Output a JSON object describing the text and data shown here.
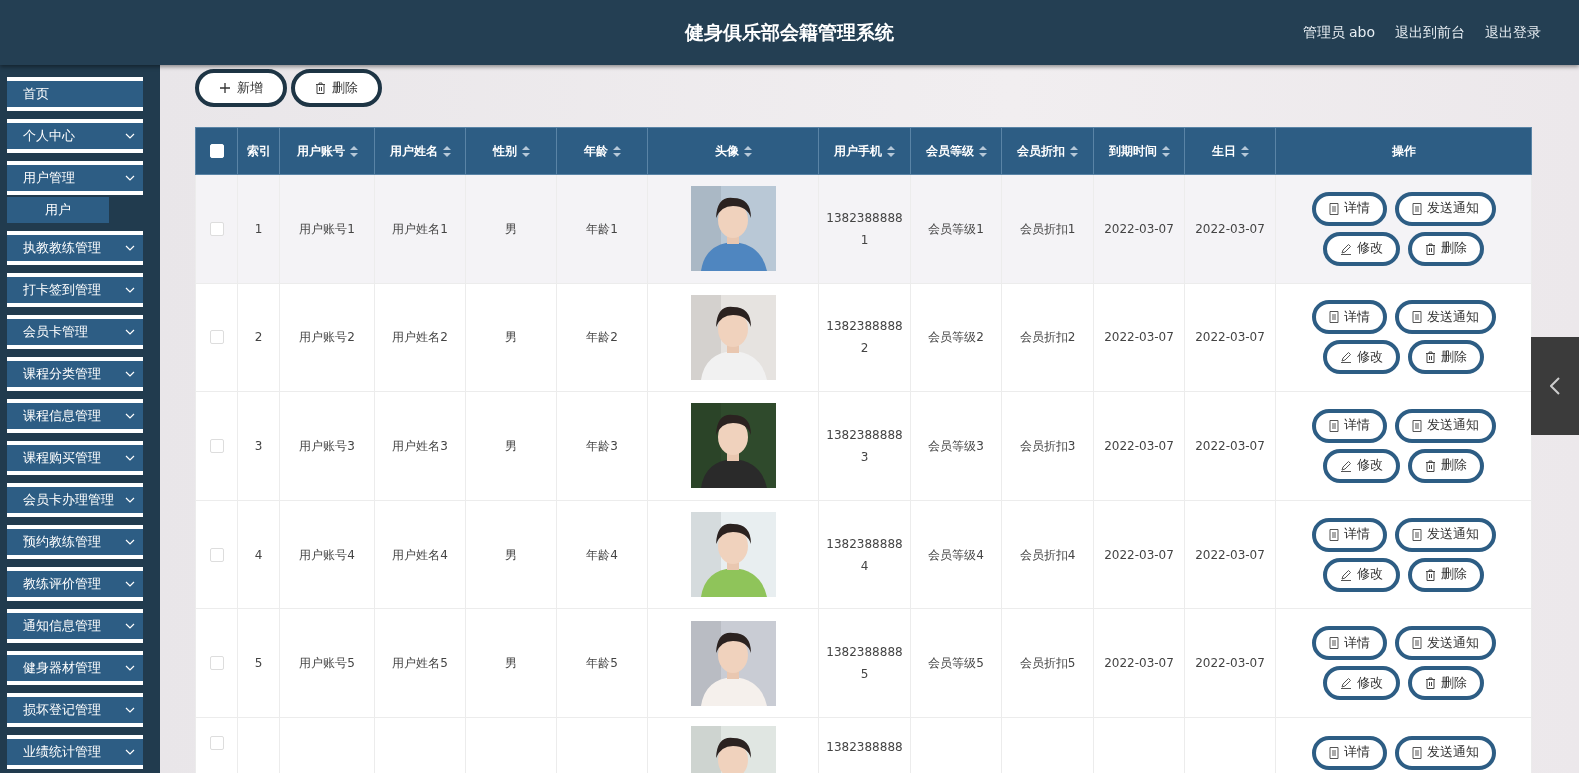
{
  "header": {
    "title": "健身俱乐部会籍管理系统",
    "links": [
      "管理员 abo",
      "退出到前台",
      "退出登录"
    ]
  },
  "sidebar": {
    "items": [
      {
        "label": "首页",
        "expandable": false
      },
      {
        "label": "个人中心",
        "expandable": true
      },
      {
        "label": "用户管理",
        "expandable": true,
        "children": [
          {
            "label": "用户"
          }
        ]
      },
      {
        "label": "执教教练管理",
        "expandable": true
      },
      {
        "label": "打卡签到管理",
        "expandable": true
      },
      {
        "label": "会员卡管理",
        "expandable": true
      },
      {
        "label": "课程分类管理",
        "expandable": true
      },
      {
        "label": "课程信息管理",
        "expandable": true
      },
      {
        "label": "课程购买管理",
        "expandable": true
      },
      {
        "label": "会员卡办理管理",
        "expandable": true
      },
      {
        "label": "预约教练管理",
        "expandable": true
      },
      {
        "label": "教练评价管理",
        "expandable": true
      },
      {
        "label": "通知信息管理",
        "expandable": true
      },
      {
        "label": "健身器材管理",
        "expandable": true
      },
      {
        "label": "损坏登记管理",
        "expandable": true
      },
      {
        "label": "业绩统计管理",
        "expandable": true
      }
    ]
  },
  "toolbar": {
    "buttons": [
      {
        "kind": "add",
        "label": "新增"
      },
      {
        "kind": "delete",
        "label": "删除"
      }
    ]
  },
  "table": {
    "columns": [
      {
        "label": "索引",
        "sortable": false
      },
      {
        "label": "用户账号",
        "sortable": true
      },
      {
        "label": "用户姓名",
        "sortable": true
      },
      {
        "label": "性别",
        "sortable": true
      },
      {
        "label": "年龄",
        "sortable": true
      },
      {
        "label": "头像",
        "sortable": true
      },
      {
        "label": "用户手机",
        "sortable": true
      },
      {
        "label": "会员等级",
        "sortable": true
      },
      {
        "label": "会员折扣",
        "sortable": true
      },
      {
        "label": "到期时间",
        "sortable": true
      },
      {
        "label": "生日",
        "sortable": true
      },
      {
        "label": "操作",
        "sortable": false
      }
    ],
    "select_all": false,
    "rows": [
      {
        "highlighted": true,
        "checked": false,
        "cells": [
          "1",
          "用户账号1",
          "用户姓名1",
          "男",
          "年龄1",
          {
            "kind": "picture"
          },
          "13823888881",
          "会员等级1",
          "会员折扣1",
          "2022-03-07",
          "2022-03-07"
        ],
        "actions": [
          {
            "kind": "doc",
            "label": "详情"
          },
          {
            "kind": "doc",
            "label": "发送通知"
          },
          {
            "kind": "edit",
            "label": "修改"
          },
          {
            "kind": "delete",
            "label": "删除"
          }
        ]
      },
      {
        "highlighted": false,
        "checked": false,
        "cells": [
          "2",
          "用户账号2",
          "用户姓名2",
          "男",
          "年龄2",
          {
            "kind": "picture"
          },
          "13823888882",
          "会员等级2",
          "会员折扣2",
          "2022-03-07",
          "2022-03-07"
        ],
        "actions": [
          {
            "kind": "doc",
            "label": "详情"
          },
          {
            "kind": "doc",
            "label": "发送通知"
          },
          {
            "kind": "edit",
            "label": "修改"
          },
          {
            "kind": "delete",
            "label": "删除"
          }
        ]
      },
      {
        "highlighted": false,
        "checked": false,
        "cells": [
          "3",
          "用户账号3",
          "用户姓名3",
          "男",
          "年龄3",
          {
            "kind": "picture"
          },
          "13823888883",
          "会员等级3",
          "会员折扣3",
          "2022-03-07",
          "2022-03-07"
        ],
        "actions": [
          {
            "kind": "doc",
            "label": "详情"
          },
          {
            "kind": "doc",
            "label": "发送通知"
          },
          {
            "kind": "edit",
            "label": "修改"
          },
          {
            "kind": "delete",
            "label": "删除"
          }
        ]
      },
      {
        "highlighted": false,
        "checked": false,
        "cells": [
          "4",
          "用户账号4",
          "用户姓名4",
          "男",
          "年龄4",
          {
            "kind": "picture"
          },
          "13823888884",
          "会员等级4",
          "会员折扣4",
          "2022-03-07",
          "2022-03-07"
        ],
        "actions": [
          {
            "kind": "doc",
            "label": "详情"
          },
          {
            "kind": "doc",
            "label": "发送通知"
          },
          {
            "kind": "edit",
            "label": "修改"
          },
          {
            "kind": "delete",
            "label": "删除"
          }
        ]
      },
      {
        "highlighted": false,
        "checked": false,
        "cells": [
          "5",
          "用户账号5",
          "用户姓名5",
          "男",
          "年龄5",
          {
            "kind": "picture"
          },
          "13823888885",
          "会员等级5",
          "会员折扣5",
          "2022-03-07",
          "2022-03-07"
        ],
        "actions": [
          {
            "kind": "doc",
            "label": "详情"
          },
          {
            "kind": "doc",
            "label": "发送通知"
          },
          {
            "kind": "edit",
            "label": "修改"
          },
          {
            "kind": "delete",
            "label": "删除"
          }
        ]
      },
      {
        "highlighted": false,
        "checked": false,
        "cells": [
          "",
          "",
          "",
          "",
          "",
          {
            "kind": "picture"
          },
          "1382388888",
          "",
          "",
          "",
          ""
        ],
        "actions": [
          {
            "kind": "doc",
            "label": "详情"
          },
          {
            "kind": "doc",
            "label": "发送通知"
          }
        ]
      }
    ]
  }
}
